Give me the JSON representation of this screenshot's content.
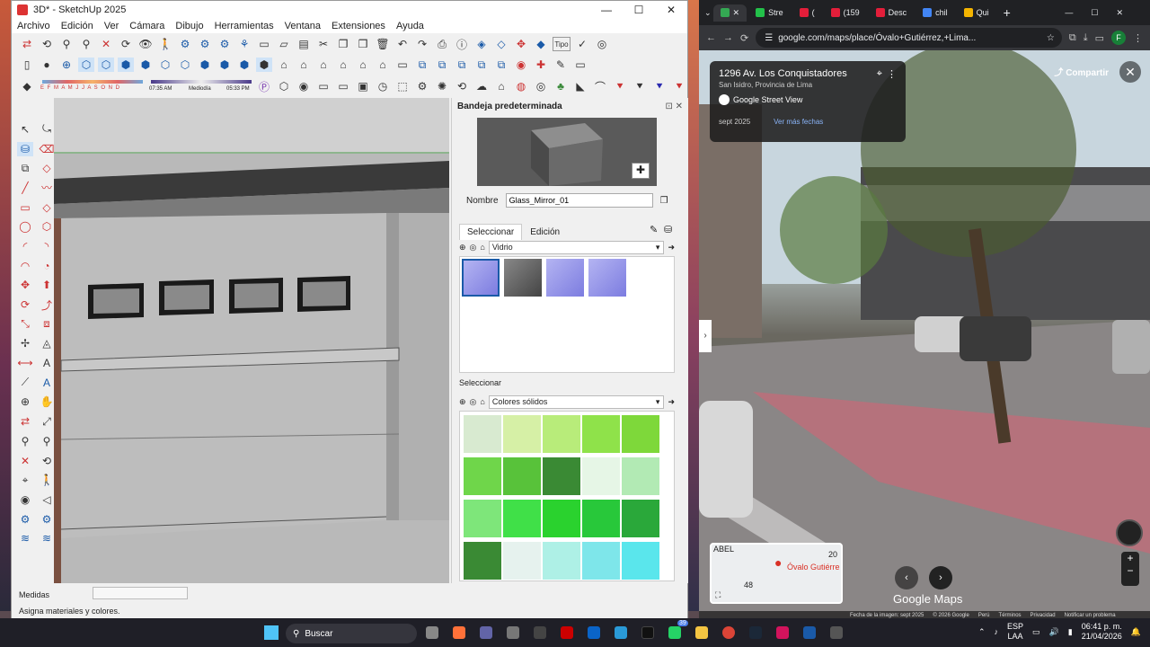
{
  "sketchup": {
    "title": "3D* - SketchUp 2025",
    "menu": [
      "Archivo",
      "Edición",
      "Ver",
      "Cámara",
      "Dibujo",
      "Herramientas",
      "Ventana",
      "Extensiones",
      "Ayuda"
    ],
    "shadow_scale": "E  F  M  A  M  J  J  A  S  O  N  D",
    "time_start": "07:35 AM",
    "time_mid": "Mediodía",
    "time_end": "05:33 PM",
    "tray_title": "Bandeja predeterminada",
    "name_label": "Nombre",
    "name_value": "Glass_Mirror_01",
    "tab_select": "Seleccionar",
    "tab_edit": "Edición",
    "library_top": "Vidrio",
    "select_label_2": "Seleccionar",
    "library_bottom": "Colores sólidos",
    "measure_label": "Medidas",
    "status_text": "Asigna materiales y colores.",
    "tip_text": "Tipo"
  },
  "chrome": {
    "tabs": [
      {
        "label": "Stre",
        "color": "#23c14a"
      },
      {
        "label": "(",
        "color": "#e31e3a"
      },
      {
        "label": "(159",
        "color": "#e31e3a"
      },
      {
        "label": "Desc",
        "color": "#e31e3a"
      },
      {
        "label": "chil",
        "color": "#4285f4"
      },
      {
        "label": "Qui",
        "color": "#f4b400"
      }
    ],
    "url": "google.com/maps/place/Óvalo+Gutiérrez,+Lima...",
    "profile": "F",
    "address": "1296 Av. Los Conquistadores",
    "district": "San Isidro, Provincia de Lima",
    "source": "Google Street View",
    "date": "sept 2025",
    "more_dates": "Ver más fechas",
    "share": "Compartir",
    "minimap_label": "Óvalo Gutiérre",
    "minimap_tl": "ABEL",
    "minimap_n1": "20",
    "minimap_n2": "48",
    "brand": "Google Maps",
    "footer": [
      "Fecha de la imagen: sept 2025",
      "© 2026 Google",
      "Perú",
      "Términos",
      "Privacidad",
      "Notificar un problema"
    ]
  },
  "taskbar": {
    "search": "Buscar",
    "lang": "ESP",
    "lang2": "LAA",
    "time": "06:41 p. m.",
    "date": "21/04/2026",
    "badge": "39"
  },
  "colors": {
    "glass_swatch": "#7c7ce0",
    "green_swatch": "#6fd64a"
  }
}
